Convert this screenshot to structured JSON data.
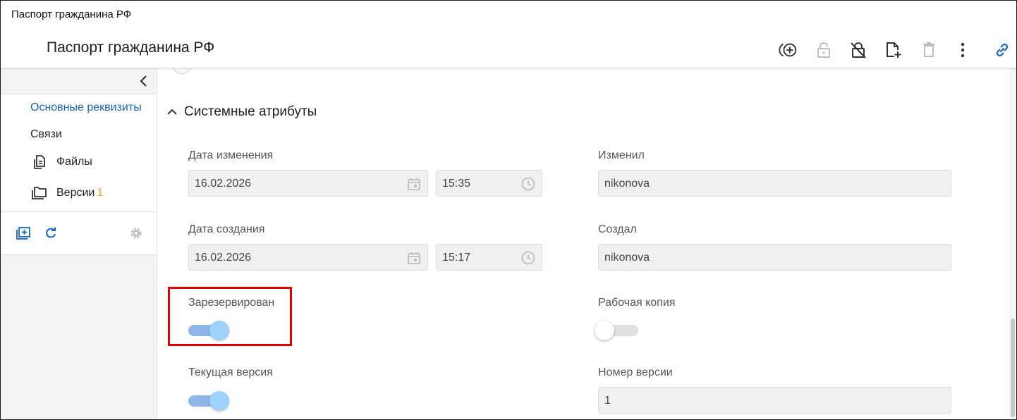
{
  "window": {
    "title": "Паспорт гражданина РФ"
  },
  "header": {
    "title": "Паспорт гражданина РФ",
    "toolbar": {
      "icons": [
        "add-circle-icon",
        "lock-icon",
        "lock-off-icon",
        "new-document-icon",
        "delete-icon",
        "more-vertical-icon",
        "link-icon"
      ]
    }
  },
  "sidebar": {
    "items": [
      {
        "label": "Основные реквизиты",
        "active": true
      },
      {
        "label": "Связи"
      },
      {
        "label": "Файлы",
        "icon": "file-icon"
      },
      {
        "label": "Версии",
        "icon": "folder-icon",
        "badge": "1"
      }
    ],
    "tools": [
      "add-folder-icon",
      "refresh-icon",
      "gear-icon"
    ]
  },
  "section": {
    "title": "Системные атрибуты",
    "fields": {
      "modified_date": {
        "label": "Дата изменения",
        "date": "16.02.2026",
        "time": "15:35"
      },
      "modified_by": {
        "label": "Изменил",
        "value": "nikonova"
      },
      "created_date": {
        "label": "Дата создания",
        "date": "16.02.2026",
        "time": "15:17"
      },
      "created_by": {
        "label": "Создал",
        "value": "nikonova"
      },
      "reserved": {
        "label": "Зарезервирован",
        "on": true
      },
      "working_copy": {
        "label": "Рабочая копия",
        "on": false
      },
      "current_version": {
        "label": "Текущая версия",
        "on": true
      },
      "version_number": {
        "label": "Номер версии",
        "value": "1"
      }
    }
  },
  "colors": {
    "accent": "#1565c0",
    "badge": "#f5a623",
    "highlight": "#e00000",
    "toggle_on_track": "#8fb6e8",
    "toggle_on_knob": "#9fd3ff"
  }
}
